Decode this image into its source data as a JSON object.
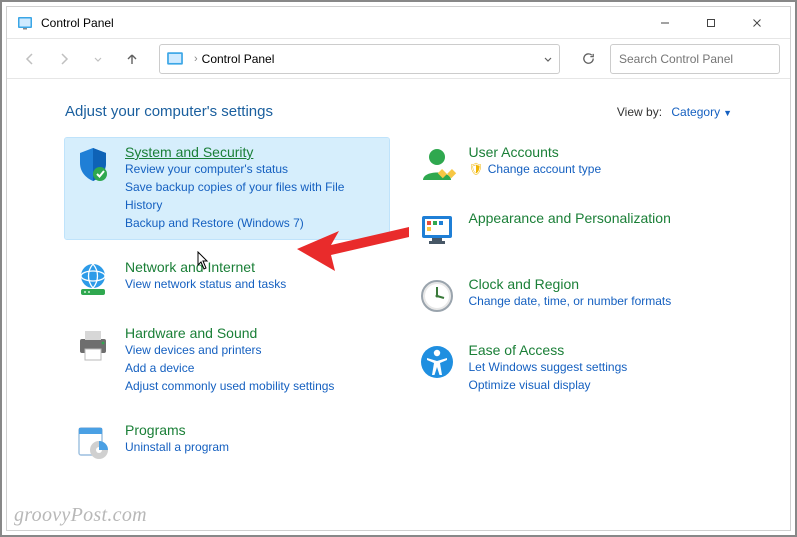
{
  "window": {
    "title": "Control Panel"
  },
  "address": {
    "crumb": "Control Panel"
  },
  "search": {
    "placeholder": "Search Control Panel"
  },
  "heading": "Adjust your computer's settings",
  "viewby": {
    "label": "View by:",
    "value": "Category"
  },
  "cats": {
    "sys": {
      "title": "System and Security",
      "l1": "Review your computer's status",
      "l2": "Save backup copies of your files with File History",
      "l3": "Backup and Restore (Windows 7)"
    },
    "net": {
      "title": "Network and Internet",
      "l1": "View network status and tasks"
    },
    "hw": {
      "title": "Hardware and Sound",
      "l1": "View devices and printers",
      "l2": "Add a device",
      "l3": "Adjust commonly used mobility settings"
    },
    "prog": {
      "title": "Programs",
      "l1": "Uninstall a program"
    },
    "user": {
      "title": "User Accounts",
      "l1": "Change account type"
    },
    "appr": {
      "title": "Appearance and Personalization"
    },
    "clock": {
      "title": "Clock and Region",
      "l1": "Change date, time, or number formats"
    },
    "ease": {
      "title": "Ease of Access",
      "l1": "Let Windows suggest settings",
      "l2": "Optimize visual display"
    }
  },
  "watermark": "groovyPost.com"
}
